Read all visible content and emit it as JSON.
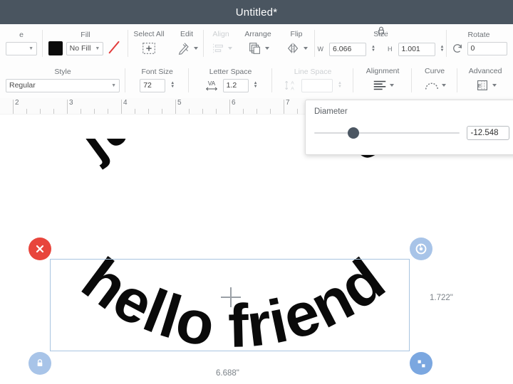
{
  "window": {
    "title": "Untitled*"
  },
  "toolbar_row1": {
    "linetype": {
      "label": "e",
      "value": "",
      "caret": "chevron-down-icon"
    },
    "fill": {
      "label": "Fill",
      "swatch_color": "#0b0b0b",
      "select_value": "No Fill",
      "noline_icon": "no-line-icon"
    },
    "select_all": {
      "label": "Select All",
      "icon": "select-all-icon"
    },
    "edit": {
      "label": "Edit",
      "icon": "edit-icon"
    },
    "align": {
      "label": "Align",
      "icon": "align-icon",
      "disabled": true
    },
    "arrange": {
      "label": "Arrange",
      "icon": "arrange-icon"
    },
    "flip": {
      "label": "Flip",
      "icon": "flip-icon"
    },
    "size": {
      "label": "Size",
      "lock_icon": "lock-aspect-icon",
      "w_label": "W",
      "w_value": "6.066",
      "h_label": "H",
      "h_value": "1.001"
    },
    "rotate": {
      "label": "Rotate",
      "icon": "rotate-icon",
      "value": "0"
    }
  },
  "toolbar_row2": {
    "style": {
      "label": "Style",
      "value": "Regular"
    },
    "font_size": {
      "label": "Font Size",
      "value": "72"
    },
    "letter_space": {
      "label": "Letter Space",
      "icon": "kerning-va-icon",
      "value": "1.2"
    },
    "line_space": {
      "label": "Line Space",
      "icon": "line-space-icon",
      "value": "",
      "disabled": true
    },
    "alignment": {
      "label": "Alignment",
      "icon": "text-align-icon"
    },
    "curve": {
      "label": "Curve",
      "icon": "curve-icon"
    },
    "advanced": {
      "label": "Advanced",
      "icon": "advanced-text-icon"
    }
  },
  "ruler": {
    "marks": [
      "2",
      "3",
      "4",
      "5",
      "6",
      "7"
    ]
  },
  "curve_popover": {
    "label": "Diameter",
    "value": "-12.548",
    "slider_percent": 26,
    "slider_min_label": "",
    "slider_max_label": ""
  },
  "canvas": {
    "text_objects": [
      {
        "name": "just peachy",
        "text": "just peachy",
        "curve": "convex"
      },
      {
        "name": "hello friend",
        "text": "hello friend",
        "curve": "concave",
        "selected": true
      }
    ],
    "selection": {
      "width_label": "6.688\"",
      "height_label": "1.722\"",
      "handles": {
        "delete": "delete-handle-icon",
        "rotate": "rotate-handle-icon",
        "lock": "lock-handle-icon",
        "resize": "resize-handle-icon"
      }
    },
    "cursor": "crosshair-cursor"
  }
}
